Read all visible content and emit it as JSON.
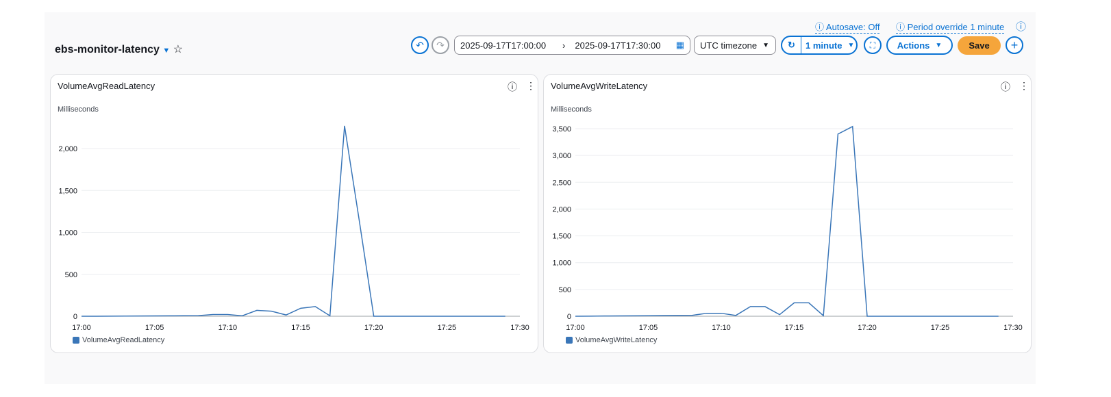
{
  "header": {
    "title": "ebs-monitor-latency",
    "autosave": "Autosave: Off",
    "period_override": "Period override 1 minute",
    "start": "2025-09-17T17:00:00",
    "end": "2025-09-17T17:30:00",
    "timezone": "UTC timezone",
    "refresh": "1 minute",
    "actions": "Actions",
    "save": "Save"
  },
  "colors": {
    "accent": "#0972d3",
    "save": "#f5a53b",
    "series": "#3a76b8"
  },
  "chart_data": [
    {
      "type": "line",
      "title": "VolumeAvgReadLatency",
      "ylabel": "Milliseconds",
      "ylim": [
        0,
        2250
      ],
      "yticks": [
        "0",
        "500",
        "1,000",
        "1,500",
        "2,000"
      ],
      "ytick_values": [
        0,
        500,
        1000,
        1500,
        2000
      ],
      "xticks": [
        "17:00",
        "17:05",
        "17:10",
        "17:15",
        "17:20",
        "17:25",
        "17:30"
      ],
      "x": [
        "17:00",
        "17:01",
        "17:02",
        "17:03",
        "17:04",
        "17:05",
        "17:06",
        "17:07",
        "17:08",
        "17:09",
        "17:10",
        "17:11",
        "17:12",
        "17:13",
        "17:14",
        "17:15",
        "17:16",
        "17:17",
        "17:18",
        "17:19",
        "17:20",
        "17:21",
        "17:22",
        "17:23",
        "17:24",
        "17:25",
        "17:26",
        "17:27",
        "17:28",
        "17:29"
      ],
      "series": [
        {
          "name": "VolumeAvgReadLatency",
          "values": [
            0,
            0,
            1,
            2,
            3,
            4,
            5,
            6,
            7,
            20,
            20,
            5,
            70,
            60,
            15,
            95,
            115,
            5,
            2270,
            1150,
            0,
            0,
            0,
            0,
            0,
            0,
            0,
            0,
            0,
            0
          ]
        }
      ],
      "legend": "bottom-left"
    },
    {
      "type": "line",
      "title": "VolumeAvgWriteLatency",
      "ylabel": "Milliseconds",
      "ylim": [
        0,
        3700
      ],
      "yticks": [
        "0",
        "500",
        "1,000",
        "1,500",
        "2,000",
        "2,500",
        "3,000",
        "3,500"
      ],
      "ytick_values": [
        0,
        500,
        1000,
        1500,
        2000,
        2500,
        3000,
        3500
      ],
      "xticks": [
        "17:00",
        "17:05",
        "17:10",
        "17:15",
        "17:20",
        "17:25",
        "17:30"
      ],
      "x": [
        "17:00",
        "17:01",
        "17:02",
        "17:03",
        "17:04",
        "17:05",
        "17:06",
        "17:07",
        "17:08",
        "17:09",
        "17:10",
        "17:11",
        "17:12",
        "17:13",
        "17:14",
        "17:15",
        "17:16",
        "17:17",
        "17:18",
        "17:19",
        "17:20",
        "17:21",
        "17:22",
        "17:23",
        "17:24",
        "17:25",
        "17:26",
        "17:27",
        "17:28",
        "17:29"
      ],
      "series": [
        {
          "name": "VolumeAvgWriteLatency",
          "values": [
            0,
            2,
            4,
            6,
            8,
            10,
            12,
            14,
            16,
            55,
            55,
            15,
            180,
            180,
            30,
            250,
            250,
            10,
            3400,
            3540,
            0,
            0,
            0,
            0,
            0,
            0,
            0,
            0,
            0,
            0
          ]
        }
      ],
      "legend": "bottom-left"
    }
  ]
}
